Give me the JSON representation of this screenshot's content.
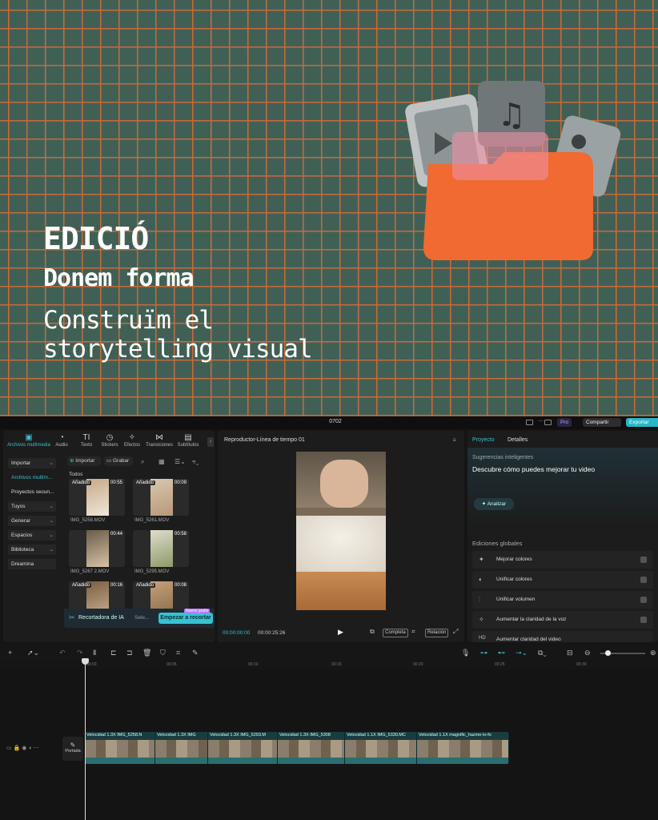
{
  "hero": {
    "title": "EDICIÓ",
    "subtitle": "Donem forma",
    "desc1": "Construïm el",
    "desc2": "storytelling visual"
  },
  "colors": {
    "bg": "#416055",
    "grid": "#c86a3c",
    "accent": "#36c2d1",
    "folder": "#f06a32"
  },
  "topbar": {
    "doc_title": "0702",
    "pro": "Pro",
    "share": "Compartir",
    "export": "Exportar"
  },
  "tools": [
    {
      "icon": "media-icon",
      "label": "Archivos multimedia",
      "glyph": "▣"
    },
    {
      "icon": "audio-icon",
      "label": "Audio",
      "glyph": "◔"
    },
    {
      "icon": "text-icon",
      "label": "Texto",
      "glyph": "TI"
    },
    {
      "icon": "stickers-icon",
      "label": "Stickers",
      "glyph": "◷"
    },
    {
      "icon": "effects-icon",
      "label": "Efectos",
      "glyph": "✧"
    },
    {
      "icon": "transitions-icon",
      "label": "Transiciones",
      "glyph": "⋈"
    },
    {
      "icon": "subtitles-icon",
      "label": "Subtítulos",
      "glyph": "▤"
    }
  ],
  "sidebar": [
    {
      "label": "Importar",
      "chev": "⌄"
    },
    {
      "label": "Archivos multim...",
      "chev": ""
    },
    {
      "label": "Proyectos secun...",
      "chev": ""
    },
    {
      "label": "Tuyos",
      "chev": "⌄"
    },
    {
      "label": "Generar",
      "chev": "⌄"
    },
    {
      "label": "Espacios",
      "chev": "⌄"
    },
    {
      "label": "Biblioteca",
      "chev": "⌄"
    },
    {
      "label": "Dreamina",
      "chev": ""
    }
  ],
  "media": {
    "import": "Importar",
    "record": "Grabar",
    "all": "Todos",
    "clips": [
      {
        "badge": "Añadido",
        "dur": "00:55",
        "name": "IMG_5258.MOV"
      },
      {
        "badge": "Añadido",
        "dur": "00:09",
        "name": "IMG_5261.MOV"
      },
      {
        "badge": "",
        "dur": "00:44",
        "name": "IMG_5267 2.MOV"
      },
      {
        "badge": "",
        "dur": "00:58",
        "name": "IMG_5295.MOV"
      },
      {
        "badge": "Añadido",
        "dur": "00:16",
        "name": ""
      },
      {
        "badge": "Añadido",
        "dur": "00:08",
        "name": ""
      }
    ]
  },
  "ai": {
    "label": "Recortadora de IA",
    "select": "Sele...",
    "start": "Empezar a recortar",
    "tag": "Nuevo gratis"
  },
  "player": {
    "title": "Reproductor-Línea de tiempo 01",
    "current": "00:00:00:00",
    "total": "00:00:25:26",
    "full": "Completa",
    "ratio": "Relación"
  },
  "props": {
    "tab1": "Proyecto",
    "tab2": "Detalles",
    "sug_label": "Sugerencias inteligentes",
    "sug_title": "Descubre cómo puedes mejorar tu video",
    "analyze": "Analizar",
    "global": "Ediciones globales",
    "items": [
      {
        "icon": "wand-icon",
        "glyph": "✦",
        "label": "Mejorar colores"
      },
      {
        "icon": "palette-icon",
        "glyph": "◐",
        "label": "Unificar colores"
      },
      {
        "icon": "volume-sliders-icon",
        "glyph": "⫶",
        "label": "Unificar volumen"
      },
      {
        "icon": "voice-icon",
        "glyph": "✧",
        "label": "Aumentar la claridad de la voz"
      },
      {
        "icon": "hd-icon",
        "glyph": "HD",
        "label": "Aumentar claridad del video"
      }
    ]
  },
  "ruler": [
    "00:00",
    "00:05",
    "00:10",
    "00:15",
    "00:20",
    "00:25",
    "00:30"
  ],
  "timeline": {
    "cover": "Portada",
    "segments": [
      {
        "label": "Velocidad 1.3X  IMG_5258.N",
        "w": 88
      },
      {
        "label": "Velocidad 1.3X  IMG",
        "w": 66
      },
      {
        "label": "Velocidad 1.3X  IMG_5293.M",
        "w": 87
      },
      {
        "label": "Velocidad 1.3X  IMG_5308",
        "w": 84
      },
      {
        "label": "Velocidad 1.1X  IMG_5330.MC",
        "w": 90
      },
      {
        "label": "Velocidad 1.1X  magnific_hazme-lo-fo",
        "w": 115
      }
    ]
  }
}
